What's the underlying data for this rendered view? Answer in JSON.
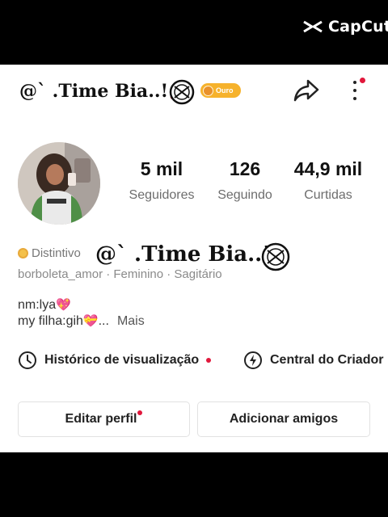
{
  "watermark": {
    "text": "CapCut",
    "icon": "capcut-logo-icon"
  },
  "header": {
    "username": "@` .Time Bia..!",
    "username_decor": "🍒",
    "badge_label": "Ouro",
    "share_icon": "share-arrow-icon",
    "menu_icon": "more-vertical-icon"
  },
  "stats": [
    {
      "value": "5 mil",
      "label": "Seguidores"
    },
    {
      "value": "126",
      "label": "Seguindo"
    },
    {
      "value": "44,9 mil",
      "label": "Curtidas"
    }
  ],
  "profile": {
    "badge_text": "Distintivo",
    "meta": "borboleta_amor · Feminino · Sagitário",
    "bio_line1": "nm:lya",
    "bio_heart1": "💖",
    "bio_line2": "my filha:gih",
    "bio_heart2": "💝",
    "bio_ellipsis": "...",
    "more_label": "Mais"
  },
  "overlay_text": "@` .Time Bia..!",
  "links": [
    {
      "label": "Histórico de visualização",
      "icon": "clock-icon"
    },
    {
      "label": "Central do Criador",
      "icon": "lightning-icon"
    }
  ],
  "buttons": {
    "edit": "Editar perfil",
    "add_friends": "Adicionar amigos"
  },
  "colors": {
    "accent_red": "#e1183c",
    "badge_gold": "#f6b22c"
  }
}
